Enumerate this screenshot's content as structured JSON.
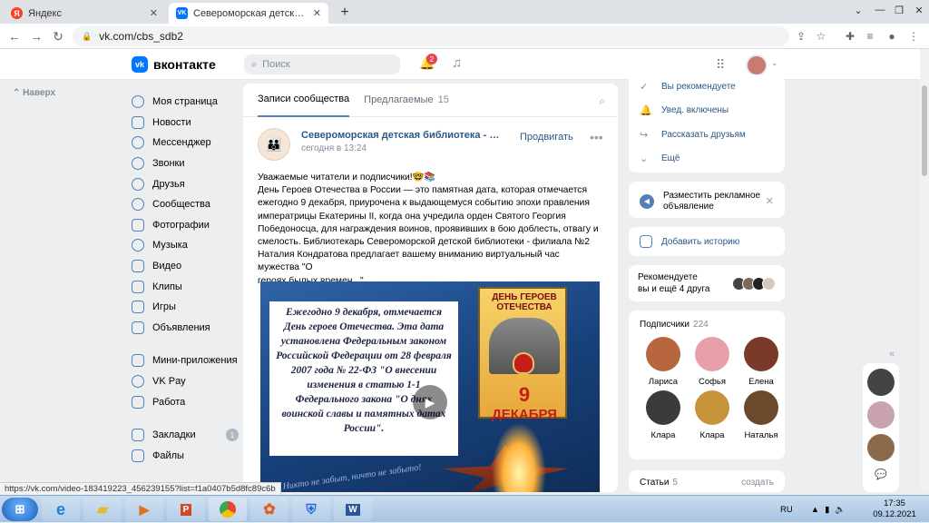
{
  "browser": {
    "tabs": [
      {
        "title": "Яндекс",
        "favicon": "yandex-icon",
        "active": false
      },
      {
        "title": "Североморская детская библис",
        "favicon": "vk-icon",
        "active": true
      }
    ],
    "url": "vk.com/cbs_sdb2",
    "status_url": "https://vk.com/video-183419223_456239155?list=f1a0407b5d8fc89c6b"
  },
  "vk": {
    "logo_text": "вконтакте",
    "logo_mark": "vk",
    "search_placeholder": "Поиск",
    "notifications_count": "2",
    "back_label": "Наверх",
    "nav": [
      {
        "label": "Моя страница",
        "icon": "user-icon"
      },
      {
        "label": "Новости",
        "icon": "news-icon"
      },
      {
        "label": "Мессенджер",
        "icon": "message-icon"
      },
      {
        "label": "Звонки",
        "icon": "phone-icon"
      },
      {
        "label": "Друзья",
        "icon": "friends-icon"
      },
      {
        "label": "Сообщества",
        "icon": "groups-icon"
      },
      {
        "label": "Фотографии",
        "icon": "photo-icon"
      },
      {
        "label": "Музыка",
        "icon": "music-icon"
      },
      {
        "label": "Видео",
        "icon": "video-icon"
      },
      {
        "label": "Клипы",
        "icon": "clips-icon"
      },
      {
        "label": "Игры",
        "icon": "games-icon"
      },
      {
        "label": "Объявления",
        "icon": "ads-icon"
      },
      {
        "label": "Мини-приложения",
        "icon": "apps-icon"
      },
      {
        "label": "VK Pay",
        "icon": "vkpay-icon"
      },
      {
        "label": "Работа",
        "icon": "work-icon"
      },
      {
        "label": "Закладки",
        "icon": "bookmark-icon",
        "count": "1"
      },
      {
        "label": "Файлы",
        "icon": "file-icon"
      }
    ],
    "feed": {
      "tab_posts": "Записи сообщества",
      "tab_suggested": "Предлагаемые",
      "tab_suggested_count": "15",
      "post": {
        "author": "Североморская детская библиотека - филиа...",
        "time": "сегодня в 13:24",
        "promote": "Продвигать",
        "text_lines": [
          "Уважаемые читатели и подписчики!🤓📚",
          "День Героев Отечества в России — это памятная дата, которая отмечается",
          "ежегодно 9 декабря, приурочена к выдающемуся событию эпохи правления",
          "императрицы Екатерины II, когда она учредила орден Святого Георгия",
          "Победоносца, для награждения воинов, проявивших в бою доблесть, отвагу и",
          "смелость. Библиотекарь Североморской детской библиотеки - филиала №2",
          "Наталия Кондратова предлагает вашему вниманию виртуальный час мужества \"О",
          "героях былых времен...\""
        ],
        "video": {
          "box_text": "Ежегодно 9 декабря, отмечается День героев Отечества. Эта дата установлена Федеральным законом Российской Федерации от 28 февраля 2007 года № 22-ФЗ \"О внесении изменения в статью 1-1 Федерального закона \"О днях воинской славы и памятных датах России\".",
          "poster_top": "ДЕНЬ ГЕРОЕВ ОТЕЧЕСТВА",
          "poster_num": "9",
          "poster_month": "ДЕКАБРЯ",
          "signature": "Никто не забыт, ничто не забыто!"
        }
      }
    },
    "right": {
      "menu": [
        {
          "label": "Вы рекомендуете",
          "icon": "check-icon"
        },
        {
          "label": "Увед. включены",
          "icon": "bell-check-icon"
        },
        {
          "label": "Рассказать друзьям",
          "icon": "share-icon"
        },
        {
          "label": "Ещё",
          "icon": "chevron-down-icon"
        }
      ],
      "ad_text": "Разместить рекламное объявление",
      "story_label": "Добавить историю",
      "recommend_line1": "Рекомендуете",
      "recommend_line2": "вы и ещё 4 друга",
      "subscribers_label": "Подписчики",
      "subscribers_count": "224",
      "subscribers": [
        {
          "name": "Лариса",
          "color": "#b8663f"
        },
        {
          "name": "Софья",
          "color": "#e8a0a8"
        },
        {
          "name": "Елена",
          "color": "#7a3a2a"
        },
        {
          "name": "Клара",
          "color": "#3b3b3b"
        },
        {
          "name": "Клара",
          "color": "#c8943a"
        },
        {
          "name": "Наталья",
          "color": "#6a4a2a"
        }
      ],
      "articles_label": "Статьи",
      "articles_count": "5",
      "articles_create": "создать"
    }
  },
  "taskbar": {
    "lang": "RU",
    "time": "17:35",
    "date": "09.12.2021"
  },
  "colors": {
    "vk_blue": "#0077ff",
    "link": "#2a5885",
    "bg": "#edeef0"
  }
}
